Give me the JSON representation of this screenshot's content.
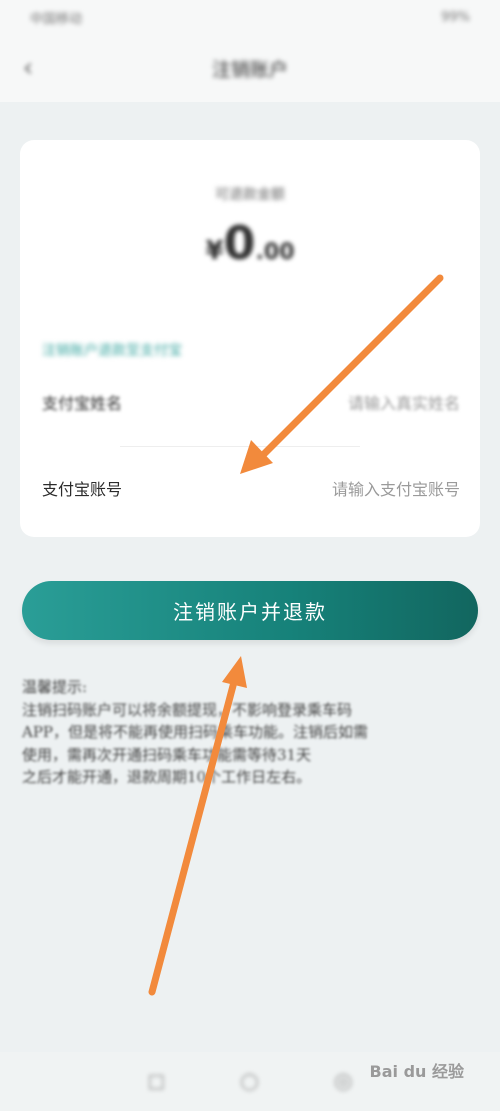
{
  "status_bar": {
    "left_text": "中国移动",
    "right_text": "99%"
  },
  "nav": {
    "title": "注销账户",
    "back_icon": "chevron-left-icon"
  },
  "balance": {
    "caption": "可退款金额",
    "currency": "¥",
    "amount": "0",
    "decimals": ".00"
  },
  "refund_hint": "注销账户退款至支付宝",
  "form": {
    "name_label": "支付宝姓名",
    "name_placeholder": "请输入真实姓名",
    "account_label": "支付宝账号",
    "account_placeholder": "请输入支付宝账号"
  },
  "submit_label": "注销账户并退款",
  "tips": {
    "title": "温馨提示:",
    "line1": "注销扫码账户可以将余额提现，不影响登录乘车码",
    "line2": "APP，但是将不能再使用扫码乘车功能。注销后如需",
    "line3": "使用，需再次开通扫码乘车功能需等待31天",
    "line4": "之后才能开通，退款周期10个工作日左右。"
  },
  "bottom_nav": {
    "icons": [
      "home-icon",
      "card-icon",
      "profile-icon"
    ]
  },
  "watermark": "Bai du 经验",
  "annotation_color": "#f28a3c"
}
